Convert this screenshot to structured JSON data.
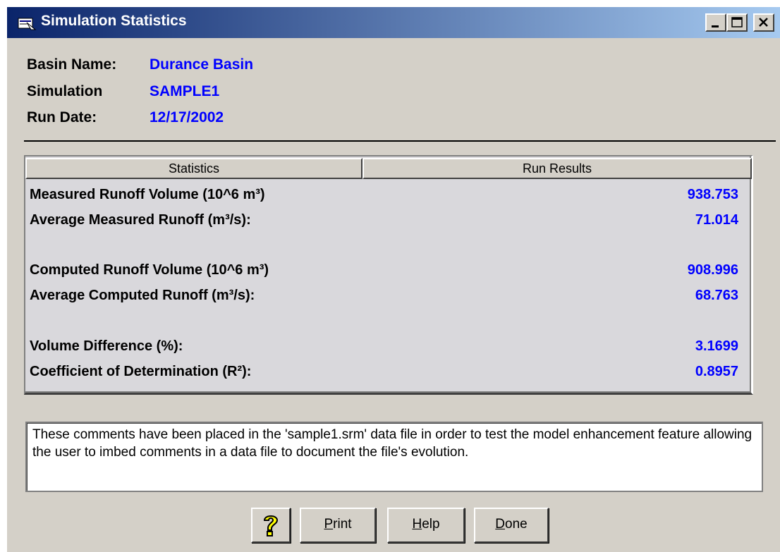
{
  "window": {
    "title": "Simulation Statistics"
  },
  "info": {
    "basin_label": "Basin Name:",
    "basin_value": "Durance Basin",
    "simulation_label": "Simulation",
    "simulation_value": "SAMPLE1",
    "run_date_label": "Run Date:",
    "run_date_value": "12/17/2002"
  },
  "stats": {
    "col_statistics": "Statistics",
    "col_results": "Run Results",
    "rows": [
      {
        "label": "Measured Runoff Volume (10^6 m³)",
        "value": "938.753"
      },
      {
        "label": "Average Measured Runoff (m³/s):",
        "value": "71.014"
      },
      {
        "label": "Computed Runoff Volume (10^6 m³)",
        "value": "908.996"
      },
      {
        "label": "Average Computed Runoff  (m³/s):",
        "value": "68.763"
      },
      {
        "label": "Volume Difference (%):",
        "value": "3.1699"
      },
      {
        "label": "Coefficient of Determination (R²):",
        "value": "0.8957"
      }
    ]
  },
  "comments": "These comments have been placed in the 'sample1.srm' data file in order to test the model enhancement feature allowing the user to imbed comments in a data file to document the file's evolution.",
  "buttons": {
    "print_m": "P",
    "print_rest": "rint",
    "help_m": "H",
    "help_rest": "elp",
    "done_m": "D",
    "done_rest": "one"
  },
  "colors": {
    "value_blue": "#0000ff",
    "titlebar_start": "#0a246a",
    "titlebar_end": "#a6caf0"
  },
  "icons": [
    "app-icon",
    "minimize-icon",
    "maximize-icon",
    "close-icon",
    "question-icon"
  ]
}
